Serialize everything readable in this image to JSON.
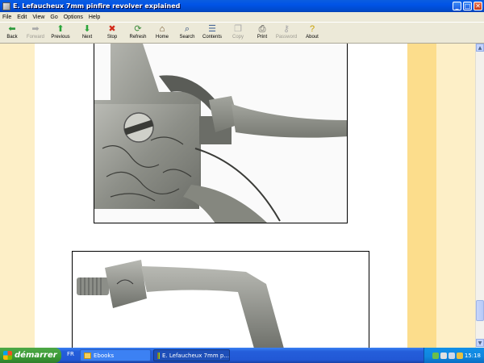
{
  "window": {
    "title": "E. Lefaucheux 7mm pinfire revolver explained",
    "controls": {
      "minimize": "_",
      "maximize": "□",
      "close": "✕"
    }
  },
  "menu": [
    "File",
    "Edit",
    "View",
    "Go",
    "Options",
    "Help"
  ],
  "toolbar": [
    {
      "label": "Back",
      "icon": "back-arrow-icon",
      "glyph": "⬅",
      "color": "#2a9a3a",
      "enabled": true
    },
    {
      "label": "Forward",
      "icon": "forward-arrow-icon",
      "glyph": "➡",
      "color": "#a9a9a9",
      "enabled": false
    },
    {
      "label": "Previous",
      "icon": "up-arrow-icon",
      "glyph": "⬆",
      "color": "#2aa53a",
      "enabled": true
    },
    {
      "label": "Next",
      "icon": "down-arrow-icon",
      "glyph": "⬇",
      "color": "#2aa53a",
      "enabled": true
    },
    {
      "label": "Stop",
      "icon": "stop-icon",
      "glyph": "✖",
      "color": "#d22a1a",
      "enabled": true
    },
    {
      "label": "Refresh",
      "icon": "refresh-icon",
      "glyph": "⟳",
      "color": "#3a8a3a",
      "enabled": true
    },
    {
      "label": "Home",
      "icon": "home-icon",
      "glyph": "⌂",
      "color": "#6a4a20",
      "enabled": true
    },
    {
      "label": "Search",
      "icon": "search-icon",
      "glyph": "⌕",
      "color": "#2a4a7a",
      "enabled": true
    },
    {
      "label": "Contents",
      "icon": "contents-icon",
      "glyph": "☰",
      "color": "#4a6a9a",
      "enabled": true
    },
    {
      "label": "Copy",
      "icon": "copy-icon",
      "glyph": "❐",
      "color": "#a9a9a9",
      "enabled": false
    },
    {
      "label": "Print",
      "icon": "printer-icon",
      "glyph": "⎙",
      "color": "#444",
      "enabled": true
    },
    {
      "label": "Password",
      "icon": "key-icon",
      "glyph": "⚷",
      "color": "#a9a9a9",
      "enabled": false
    },
    {
      "label": "About",
      "icon": "question-icon",
      "glyph": "?",
      "color": "#c8a000",
      "enabled": true
    }
  ],
  "taskbar": {
    "start_label": "démarrer",
    "language": "FR",
    "tasks": [
      {
        "label": "Ebooks",
        "icon": "folder-icon"
      },
      {
        "label": "E. Lefaucheux 7mm p...",
        "icon": "ebook-app-icon"
      }
    ],
    "clock": "15:18"
  },
  "colors": {
    "content_bg": "#ffffff",
    "stripe_light": "#fdefc7",
    "stripe_dark": "#fcdd8c"
  }
}
